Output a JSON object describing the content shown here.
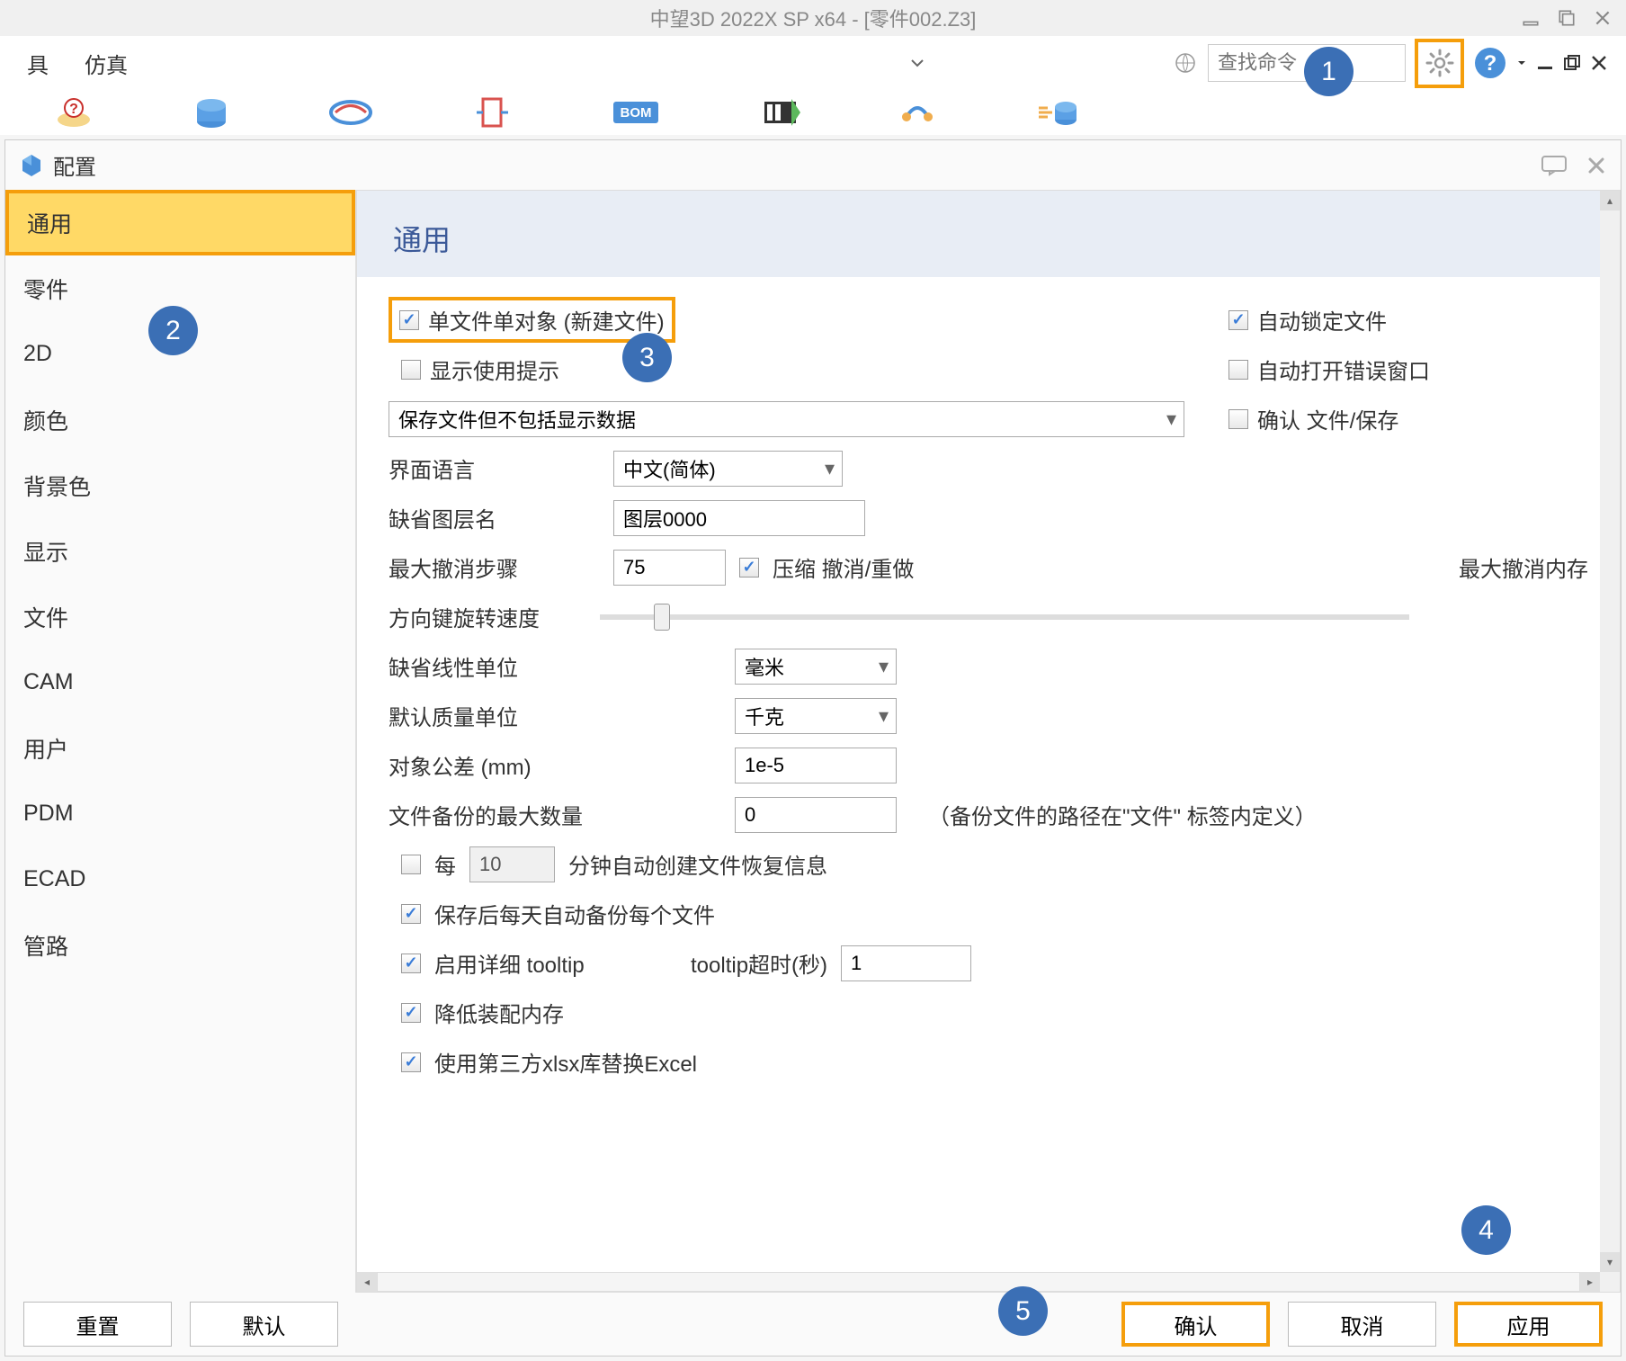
{
  "title": "中望3D 2022X SP x64 - [零件002.Z3]",
  "menu": {
    "item1": "具",
    "item2": "仿真"
  },
  "search": {
    "placeholder": "查找命令"
  },
  "config": {
    "title": "配置",
    "sidebar": {
      "items": [
        "通用",
        "零件",
        "2D",
        "颜色",
        "背景色",
        "显示",
        "文件",
        "CAM",
        "用户",
        "PDM",
        "ECAD",
        "管路"
      ]
    },
    "content": {
      "title": "通用",
      "cb_single_file": "单文件单对象 (新建文件)",
      "cb_auto_lock": "自动锁定文件",
      "cb_show_hints": "显示使用提示",
      "cb_auto_error": "自动打开错误窗口",
      "sel_save": "保存文件但不包括显示数据",
      "cb_confirm_save": "确认 文件/保存",
      "lbl_lang": "界面语言",
      "sel_lang": "中文(简体)",
      "lbl_layer": "缺省图层名",
      "val_layer": "图层0000",
      "lbl_undo": "最大撤消步骤",
      "val_undo": "75",
      "cb_compress": "压缩 撤消/重做",
      "lbl_undo_mem": "最大撤消内存",
      "lbl_rotate": "方向键旋转速度",
      "lbl_linear": "缺省线性单位",
      "sel_linear": "毫米",
      "lbl_mass": "默认质量单位",
      "sel_mass": "千克",
      "lbl_tol": "对象公差  (mm)",
      "val_tol": "1e-5",
      "lbl_backup": "文件备份的最大数量",
      "val_backup": "0",
      "lbl_backup_note": "（备份文件的路径在\"文件\" 标签内定义）",
      "cb_every": "每",
      "val_every": "10",
      "lbl_every_min": "分钟自动创建文件恢复信息",
      "cb_daily_backup": "保存后每天自动备份每个文件",
      "cb_tooltip": "启用详细 tooltip",
      "lbl_tooltip_time": "tooltip超时(秒)",
      "val_tooltip_time": "1",
      "cb_reduce_mem": "降低装配内存",
      "cb_xlsx": "使用第三方xlsx库替换Excel"
    },
    "footer": {
      "reset": "重置",
      "default": "默认",
      "ok": "确认",
      "cancel": "取消",
      "apply": "应用"
    }
  },
  "badges": {
    "b1": "1",
    "b2": "2",
    "b3": "3",
    "b4": "4",
    "b5": "5"
  }
}
